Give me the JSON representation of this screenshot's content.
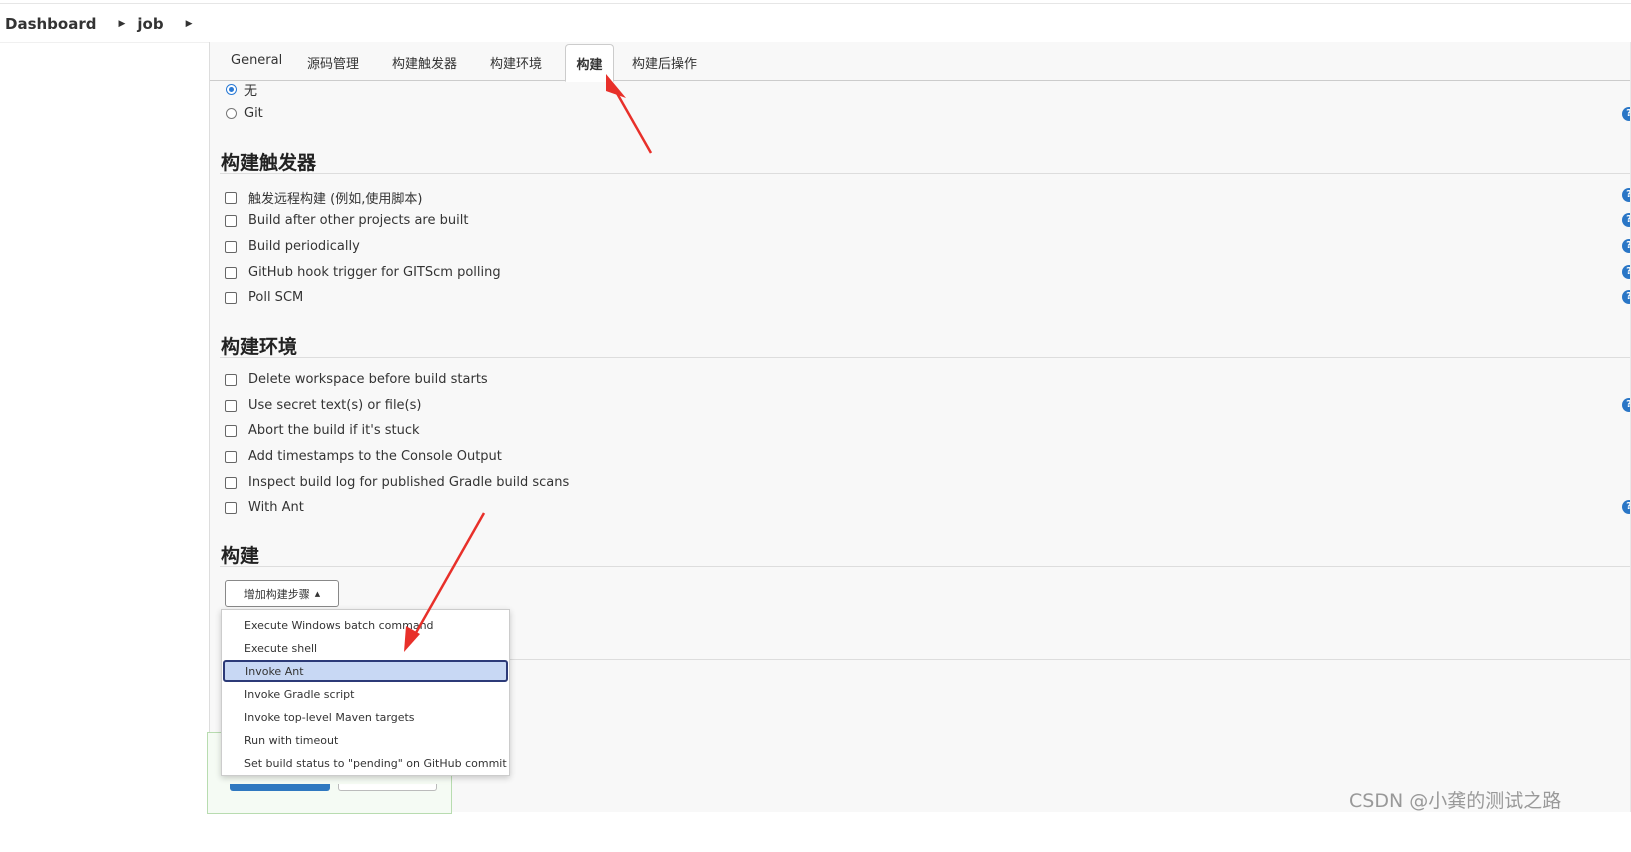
{
  "breadcrumb": {
    "items": [
      "Dashboard",
      "job"
    ],
    "separator": "▶"
  },
  "tabs": [
    "General",
    "源码管理",
    "构建触发器",
    "构建环境",
    "构建",
    "构建后操作"
  ],
  "scm": {
    "options": [
      {
        "label": "无",
        "selected": true
      },
      {
        "label": "Git",
        "selected": false
      }
    ]
  },
  "triggers": {
    "title": "构建触发器",
    "options": [
      "触发远程构建 (例如,使用脚本)",
      "Build after other projects are built",
      "Build periodically",
      "GitHub hook trigger for GITScm polling",
      "Poll SCM"
    ]
  },
  "environment": {
    "title": "构建环境",
    "options": [
      "Delete workspace before build starts",
      "Use secret text(s) or file(s)",
      "Abort the build if it's stuck",
      "Add timestamps to the Console Output",
      "Inspect build log for published Gradle build scans",
      "With Ant"
    ]
  },
  "build": {
    "title": "构建",
    "add_step_label": "增加构建步骤",
    "menu_items": [
      "Execute Windows batch command",
      "Execute shell",
      "Invoke Ant",
      "Invoke Gradle script",
      "Invoke top-level Maven targets",
      "Run with timeout",
      "Set build status to \"pending\" on GitHub commit"
    ],
    "highlighted_item": "Invoke Ant"
  },
  "help_icon": "?",
  "watermark": "CSDN @小龚的测试之路",
  "colors": {
    "accent": "#2a76c6",
    "annotation_arrow": "#e8302a",
    "highlight_bg": "#c8d8f4"
  },
  "icons": [
    "caret-right-icon",
    "caret-up-icon",
    "help-icon",
    "annotation-arrow"
  ]
}
